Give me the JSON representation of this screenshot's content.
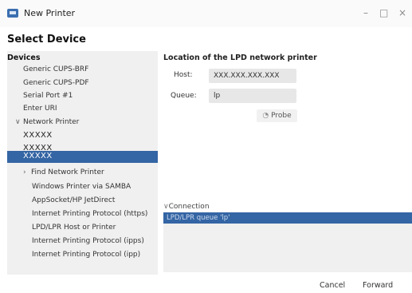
{
  "window": {
    "title": "New Printer",
    "controls": {
      "minimize": "–",
      "maximize": "□",
      "close": "×"
    }
  },
  "page": {
    "heading": "Select Device"
  },
  "sidebar": {
    "header": "Devices",
    "items": [
      {
        "label": "Generic CUPS-BRF"
      },
      {
        "label": "Generic CUPS-PDF"
      },
      {
        "label": "Serial Port #1"
      },
      {
        "label": "Enter URI"
      }
    ],
    "network_printer": {
      "label": "Network Printer",
      "expanded": true,
      "hosts": [
        {
          "label": "XXXXX"
        },
        {
          "label": "XXXXX"
        },
        {
          "label": "XXXXX",
          "selected": true
        }
      ],
      "find_label": "Find Network Printer",
      "find_expanded": false
    },
    "protocols": [
      {
        "label": "Windows Printer via SAMBA"
      },
      {
        "label": "AppSocket/HP JetDirect"
      },
      {
        "label": "Internet Printing Protocol (https)"
      },
      {
        "label": "LPD/LPR Host or Printer"
      },
      {
        "label": "Internet Printing Protocol (ipps)"
      },
      {
        "label": "Internet Printing Protocol (ipp)"
      }
    ]
  },
  "main": {
    "location_title": "Location of the LPD network printer",
    "host": {
      "label": "Host:",
      "value": "XXX.XXX.XXX.XXX"
    },
    "queue": {
      "label": "Queue:",
      "value": "lp"
    },
    "probe": {
      "icon": "probe-icon",
      "label": "Probe"
    },
    "connection": {
      "label": "Connection",
      "expanded": true,
      "rows": [
        {
          "label": "LPD/LPR queue 'lp'",
          "selected": true
        }
      ]
    }
  },
  "footer": {
    "cancel_label": "Cancel",
    "forward_label": "Forward"
  },
  "colors": {
    "selection": "#3465a4",
    "panel": "#f0f0f0",
    "field": "#e7e7e7"
  }
}
